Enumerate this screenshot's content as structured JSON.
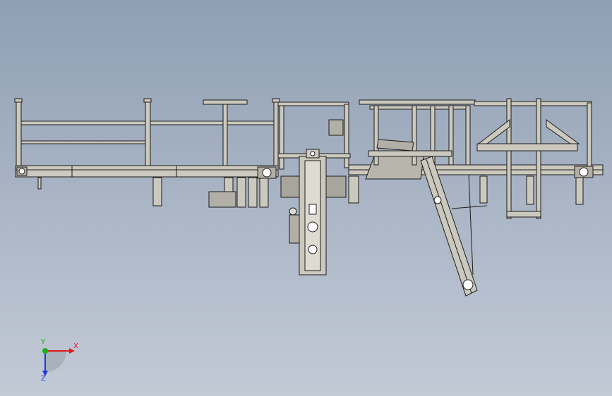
{
  "view": {
    "background_top": "#8f9fb4",
    "background_bottom": "#c3cad6",
    "line_color": "#1c1c1c",
    "part_fill": "#cbc9bd",
    "panel_fill": "#b2b0a6"
  },
  "triad": {
    "x_label": "X",
    "y_label": "Y",
    "z_label": "Z",
    "x_color": "#e11a1a",
    "y_color": "#17b117",
    "z_color": "#1a3ad6"
  }
}
